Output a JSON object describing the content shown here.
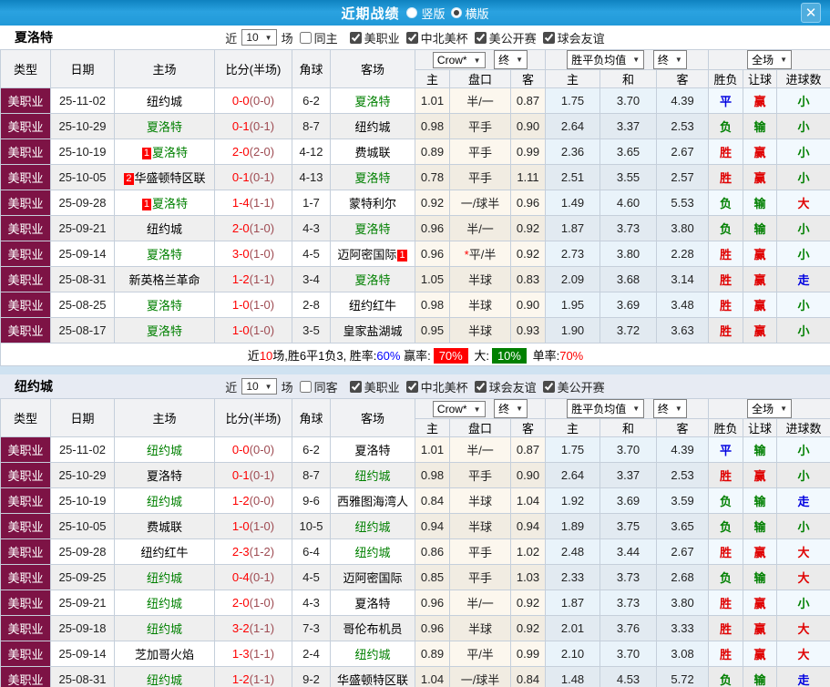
{
  "colors": {
    "titlebar_blue": "#1f9ad9",
    "type_maroon": "#7d1345",
    "team_green": "#008000",
    "score_red": "#fe0000",
    "win_red": "#e00000",
    "lose_green": "#008000",
    "draw_blue": "#0000e0",
    "rate_badge_red": "#fe0000",
    "rate_badge_green": "#008000"
  },
  "titlebar": {
    "title": "近期战绩",
    "radio_vertical": {
      "label": "竖版",
      "checked": false
    },
    "radio_horizontal": {
      "label": "横版",
      "checked": true
    },
    "close_label": "✕"
  },
  "result_color_map": {
    "胜": "r",
    "平": "b",
    "负": "g",
    "赢": "r",
    "输": "g",
    "走": "b",
    "大": "r",
    "小": "g"
  },
  "sections": [
    {
      "team": "夏洛特",
      "filter": {
        "near_label": "近",
        "games_value": "10",
        "games_label": "场",
        "same": {
          "label": "同主",
          "checked": false
        },
        "leagues": [
          {
            "label": "美职业",
            "checked": true
          },
          {
            "label": "中北美杯",
            "checked": true
          },
          {
            "label": "美公开赛",
            "checked": true
          },
          {
            "label": "球会友谊",
            "checked": true
          }
        ]
      },
      "header": {
        "col_type": "类型",
        "col_date": "日期",
        "col_home": "主场",
        "col_score": "比分(半场)",
        "col_corner": "角球",
        "col_away": "客场",
        "odds_select": "Crow*",
        "odds_final": "终",
        "mean_select": "胜平负均值",
        "mean_final": "终",
        "full_select": "全场",
        "sub": [
          "主",
          "盘口",
          "客",
          "主",
          "和",
          "客",
          "胜负",
          "让球",
          "进球数"
        ]
      },
      "rows": [
        {
          "league": "美职业",
          "date": "25-11-02",
          "home": "纽约城",
          "hg": false,
          "score": "0-0",
          "half": "(0-0)",
          "corner": "6-2",
          "away": "夏洛特",
          "ag": true,
          "o": [
            "1.01",
            "半/一",
            "0.87"
          ],
          "m": [
            "1.75",
            "3.70",
            "4.39"
          ],
          "res": [
            "平",
            "赢",
            "小"
          ]
        },
        {
          "league": "美职业",
          "date": "25-10-29",
          "home": "夏洛特",
          "hg": true,
          "score": "0-1",
          "half": "(0-1)",
          "corner": "8-7",
          "away": "纽约城",
          "ag": false,
          "o": [
            "0.98",
            "平手",
            "0.90"
          ],
          "m": [
            "2.64",
            "3.37",
            "2.53"
          ],
          "res": [
            "负",
            "输",
            "小"
          ]
        },
        {
          "league": "美职业",
          "date": "25-10-19",
          "hb": "1",
          "home": "夏洛特",
          "hg": true,
          "score": "2-0",
          "half": "(2-0)",
          "corner": "4-12",
          "away": "费城联",
          "ag": false,
          "o": [
            "0.89",
            "平手",
            "0.99"
          ],
          "m": [
            "2.36",
            "3.65",
            "2.67"
          ],
          "res": [
            "胜",
            "赢",
            "小"
          ]
        },
        {
          "league": "美职业",
          "date": "25-10-05",
          "hb": "2",
          "home": "华盛顿特区联",
          "hg": false,
          "score": "0-1",
          "half": "(0-1)",
          "corner": "4-13",
          "away": "夏洛特",
          "ag": true,
          "o": [
            "0.78",
            "平手",
            "1.11"
          ],
          "m": [
            "2.51",
            "3.55",
            "2.57"
          ],
          "res": [
            "胜",
            "赢",
            "小"
          ]
        },
        {
          "league": "美职业",
          "date": "25-09-28",
          "hb": "1",
          "home": "夏洛特",
          "hg": true,
          "score": "1-4",
          "half": "(1-1)",
          "corner": "1-7",
          "away": "蒙特利尔",
          "ag": false,
          "o": [
            "0.92",
            "一/球半",
            "0.96"
          ],
          "m": [
            "1.49",
            "4.60",
            "5.53"
          ],
          "res": [
            "负",
            "输",
            "大"
          ]
        },
        {
          "league": "美职业",
          "date": "25-09-21",
          "home": "纽约城",
          "hg": false,
          "score": "2-0",
          "half": "(1-0)",
          "corner": "4-3",
          "away": "夏洛特",
          "ag": true,
          "o": [
            "0.96",
            "半/一",
            "0.92"
          ],
          "m": [
            "1.87",
            "3.73",
            "3.80"
          ],
          "res": [
            "负",
            "输",
            "小"
          ]
        },
        {
          "league": "美职业",
          "date": "25-09-14",
          "home": "夏洛特",
          "hg": true,
          "score": "3-0",
          "half": "(1-0)",
          "corner": "4-5",
          "away": "迈阿密国际",
          "ag": false,
          "ab": "1",
          "star": true,
          "o": [
            "0.96",
            "平/半",
            "0.92"
          ],
          "m": [
            "2.73",
            "3.80",
            "2.28"
          ],
          "res": [
            "胜",
            "赢",
            "小"
          ]
        },
        {
          "league": "美职业",
          "date": "25-08-31",
          "home": "新英格兰革命",
          "hg": false,
          "score": "1-2",
          "half": "(1-1)",
          "corner": "3-4",
          "away": "夏洛特",
          "ag": true,
          "o": [
            "1.05",
            "半球",
            "0.83"
          ],
          "m": [
            "2.09",
            "3.68",
            "3.14"
          ],
          "res": [
            "胜",
            "赢",
            "走"
          ]
        },
        {
          "league": "美职业",
          "date": "25-08-25",
          "home": "夏洛特",
          "hg": true,
          "score": "1-0",
          "half": "(1-0)",
          "corner": "2-8",
          "away": "纽约红牛",
          "ag": false,
          "o": [
            "0.98",
            "半球",
            "0.90"
          ],
          "m": [
            "1.95",
            "3.69",
            "3.48"
          ],
          "res": [
            "胜",
            "赢",
            "小"
          ]
        },
        {
          "league": "美职业",
          "date": "25-08-17",
          "home": "夏洛特",
          "hg": true,
          "score": "1-0",
          "half": "(1-0)",
          "corner": "3-5",
          "away": "皇家盐湖城",
          "ag": false,
          "o": [
            "0.95",
            "半球",
            "0.93"
          ],
          "m": [
            "1.90",
            "3.72",
            "3.63"
          ],
          "res": [
            "胜",
            "赢",
            "小"
          ]
        }
      ],
      "summary": [
        {
          "t": "近",
          "c": "k"
        },
        {
          "t": "10",
          "c": "r"
        },
        {
          "t": "场,胜6平1负3, 胜率:",
          "c": "k"
        },
        {
          "t": "60%",
          "c": "b"
        },
        {
          "t": " 赢率:",
          "c": "k"
        },
        {
          "t": "70%",
          "c": "wr"
        },
        {
          "t": " 大:",
          "c": "k"
        },
        {
          "t": "10%",
          "c": "wg"
        },
        {
          "t": " 单率:",
          "c": "k"
        },
        {
          "t": "70%",
          "c": "r"
        }
      ]
    },
    {
      "team": "纽约城",
      "filter": {
        "near_label": "近",
        "games_value": "10",
        "games_label": "场",
        "same": {
          "label": "同客",
          "checked": false
        },
        "leagues": [
          {
            "label": "美职业",
            "checked": true
          },
          {
            "label": "中北美杯",
            "checked": true
          },
          {
            "label": "球会友谊",
            "checked": true
          },
          {
            "label": "美公开赛",
            "checked": true
          }
        ]
      },
      "header": {
        "col_type": "类型",
        "col_date": "日期",
        "col_home": "主场",
        "col_score": "比分(半场)",
        "col_corner": "角球",
        "col_away": "客场",
        "odds_select": "Crow*",
        "odds_final": "终",
        "mean_select": "胜平负均值",
        "mean_final": "终",
        "full_select": "全场",
        "sub": [
          "主",
          "盘口",
          "客",
          "主",
          "和",
          "客",
          "胜负",
          "让球",
          "进球数"
        ]
      },
      "rows": [
        {
          "league": "美职业",
          "date": "25-11-02",
          "home": "纽约城",
          "hg": true,
          "score": "0-0",
          "half": "(0-0)",
          "corner": "6-2",
          "away": "夏洛特",
          "ag": false,
          "o": [
            "1.01",
            "半/一",
            "0.87"
          ],
          "m": [
            "1.75",
            "3.70",
            "4.39"
          ],
          "res": [
            "平",
            "输",
            "小"
          ]
        },
        {
          "league": "美职业",
          "date": "25-10-29",
          "home": "夏洛特",
          "hg": false,
          "score": "0-1",
          "half": "(0-1)",
          "corner": "8-7",
          "away": "纽约城",
          "ag": true,
          "o": [
            "0.98",
            "平手",
            "0.90"
          ],
          "m": [
            "2.64",
            "3.37",
            "2.53"
          ],
          "res": [
            "胜",
            "赢",
            "小"
          ]
        },
        {
          "league": "美职业",
          "date": "25-10-19",
          "home": "纽约城",
          "hg": true,
          "score": "1-2",
          "half": "(0-0)",
          "corner": "9-6",
          "away": "西雅图海湾人",
          "ag": false,
          "o": [
            "0.84",
            "半球",
            "1.04"
          ],
          "m": [
            "1.92",
            "3.69",
            "3.59"
          ],
          "res": [
            "负",
            "输",
            "走"
          ]
        },
        {
          "league": "美职业",
          "date": "25-10-05",
          "home": "费城联",
          "hg": false,
          "score": "1-0",
          "half": "(1-0)",
          "corner": "10-5",
          "away": "纽约城",
          "ag": true,
          "o": [
            "0.94",
            "半球",
            "0.94"
          ],
          "m": [
            "1.89",
            "3.75",
            "3.65"
          ],
          "res": [
            "负",
            "输",
            "小"
          ]
        },
        {
          "league": "美职业",
          "date": "25-09-28",
          "home": "纽约红牛",
          "hg": false,
          "score": "2-3",
          "half": "(1-2)",
          "corner": "6-4",
          "away": "纽约城",
          "ag": true,
          "o": [
            "0.86",
            "平手",
            "1.02"
          ],
          "m": [
            "2.48",
            "3.44",
            "2.67"
          ],
          "res": [
            "胜",
            "赢",
            "大"
          ]
        },
        {
          "league": "美职业",
          "date": "25-09-25",
          "home": "纽约城",
          "hg": true,
          "score": "0-4",
          "half": "(0-1)",
          "corner": "4-5",
          "away": "迈阿密国际",
          "ag": false,
          "o": [
            "0.85",
            "平手",
            "1.03"
          ],
          "m": [
            "2.33",
            "3.73",
            "2.68"
          ],
          "res": [
            "负",
            "输",
            "大"
          ]
        },
        {
          "league": "美职业",
          "date": "25-09-21",
          "home": "纽约城",
          "hg": true,
          "score": "2-0",
          "half": "(1-0)",
          "corner": "4-3",
          "away": "夏洛特",
          "ag": false,
          "o": [
            "0.96",
            "半/一",
            "0.92"
          ],
          "m": [
            "1.87",
            "3.73",
            "3.80"
          ],
          "res": [
            "胜",
            "赢",
            "小"
          ]
        },
        {
          "league": "美职业",
          "date": "25-09-18",
          "home": "纽约城",
          "hg": true,
          "score": "3-2",
          "half": "(1-1)",
          "corner": "7-3",
          "away": "哥伦布机员",
          "ag": false,
          "o": [
            "0.96",
            "半球",
            "0.92"
          ],
          "m": [
            "2.01",
            "3.76",
            "3.33"
          ],
          "res": [
            "胜",
            "赢",
            "大"
          ]
        },
        {
          "league": "美职业",
          "date": "25-09-14",
          "home": "芝加哥火焰",
          "hg": false,
          "score": "1-3",
          "half": "(1-1)",
          "corner": "2-4",
          "away": "纽约城",
          "ag": true,
          "o": [
            "0.89",
            "平/半",
            "0.99"
          ],
          "m": [
            "2.10",
            "3.70",
            "3.08"
          ],
          "res": [
            "胜",
            "赢",
            "大"
          ]
        },
        {
          "league": "美职业",
          "date": "25-08-31",
          "home": "纽约城",
          "hg": true,
          "score": "1-2",
          "half": "(1-1)",
          "corner": "9-2",
          "away": "华盛顿特区联",
          "ag": false,
          "o": [
            "1.04",
            "一/球半",
            "0.84"
          ],
          "m": [
            "1.48",
            "4.53",
            "5.72"
          ],
          "res": [
            "负",
            "输",
            "走"
          ]
        }
      ],
      "summary": null
    }
  ]
}
